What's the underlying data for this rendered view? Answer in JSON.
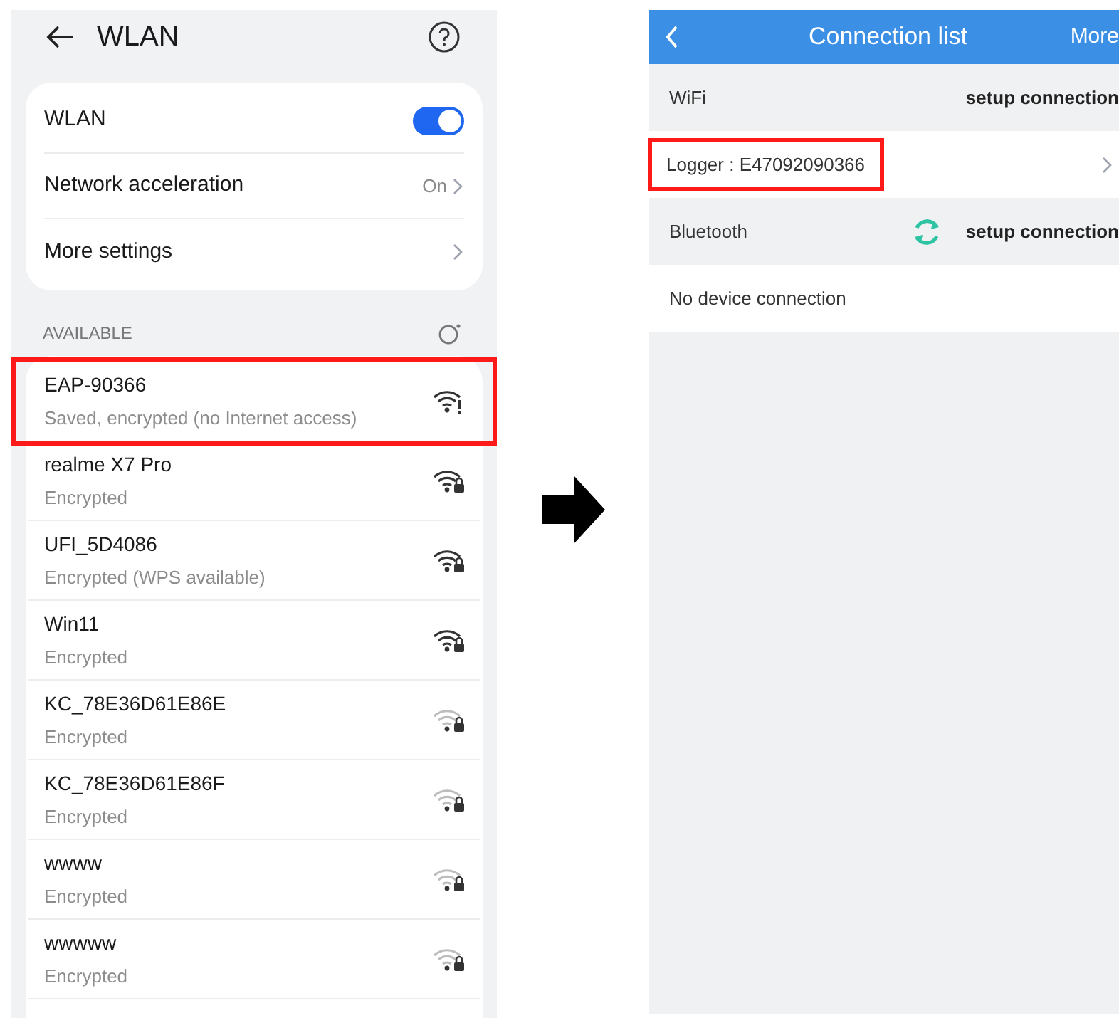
{
  "wlan_screen": {
    "title": "WLAN",
    "settings": [
      {
        "kind": "toggle",
        "label": "WLAN",
        "on": true
      },
      {
        "kind": "link",
        "label": "Network acceleration",
        "value": "On"
      },
      {
        "kind": "link",
        "label": "More settings"
      }
    ],
    "section_label": "AVAILABLE",
    "networks": [
      {
        "name": "EAP-90366",
        "detail": "Saved, encrypted (no Internet access)",
        "kind": "warning",
        "weak": false,
        "highlighted": true
      },
      {
        "name": "realme X7 Pro",
        "detail": "Encrypted",
        "kind": "lock",
        "weak": false,
        "highlighted": false
      },
      {
        "name": "UFI_5D4086",
        "detail": "Encrypted (WPS available)",
        "kind": "lock",
        "weak": false,
        "highlighted": false
      },
      {
        "name": "Win11",
        "detail": "Encrypted",
        "kind": "lock",
        "weak": false,
        "highlighted": false
      },
      {
        "name": "KC_78E36D61E86E",
        "detail": "Encrypted",
        "kind": "lock",
        "weak": true,
        "highlighted": false
      },
      {
        "name": "KC_78E36D61E86F",
        "detail": "Encrypted",
        "kind": "lock",
        "weak": true,
        "highlighted": false
      },
      {
        "name": "wwww",
        "detail": "Encrypted",
        "kind": "lock",
        "weak": true,
        "highlighted": false
      },
      {
        "name": "wwwww",
        "detail": "Encrypted",
        "kind": "lock",
        "weak": true,
        "highlighted": false
      }
    ]
  },
  "connection_screen": {
    "title": "Connection list",
    "more": "More",
    "rows": [
      {
        "kind": "section",
        "label": "WiFi",
        "action": "setup connection",
        "spinner": false
      },
      {
        "kind": "device",
        "label": "Logger : E47092090366",
        "highlighted": true
      },
      {
        "kind": "section",
        "label": "Bluetooth",
        "action": "setup connection",
        "spinner": true
      },
      {
        "kind": "message",
        "label": "No device connection"
      }
    ]
  }
}
